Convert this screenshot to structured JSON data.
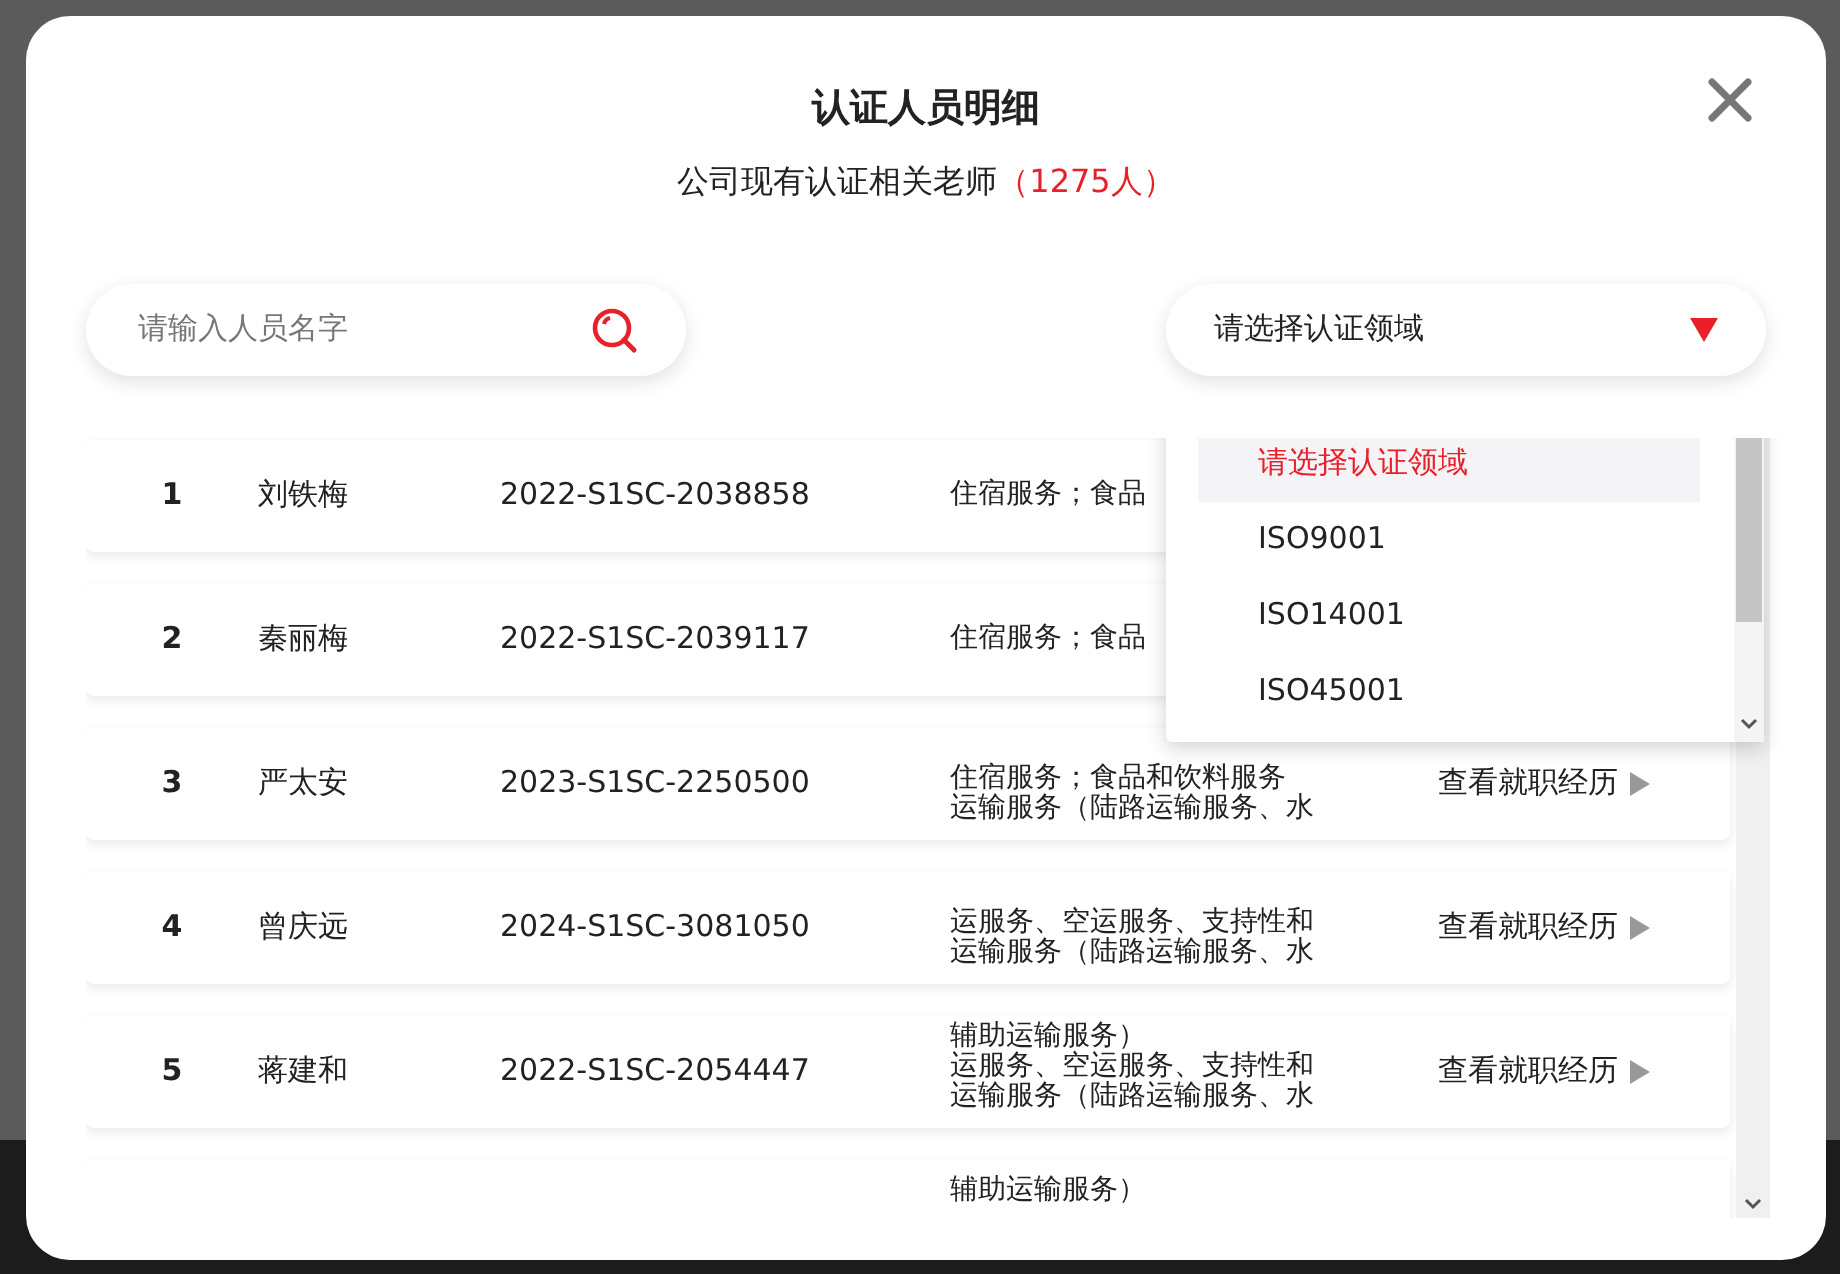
{
  "dialog": {
    "title": "认证人员明细",
    "subtitle": "公司现有认证相关老师",
    "count": "（1275人）"
  },
  "search": {
    "placeholder": "请输入人员名字"
  },
  "domain_select": {
    "value": "请选择认证领域",
    "expanded": true,
    "options": [
      {
        "label": "请选择认证领域",
        "selected": true
      },
      {
        "label": "ISO9001",
        "selected": false
      },
      {
        "label": "ISO14001",
        "selected": false
      },
      {
        "label": "ISO45001",
        "selected": false
      }
    ]
  },
  "rows": [
    {
      "no": "1",
      "name": "刘铁梅",
      "cert": "2022-S1SC-2038858",
      "services": [
        "住宿服务；食品"
      ],
      "link": null
    },
    {
      "no": "2",
      "name": "秦丽梅",
      "cert": "2022-S1SC-2039117",
      "services": [
        "住宿服务；食品"
      ],
      "link": null
    },
    {
      "no": "3",
      "name": "严太安",
      "cert": "2023-S1SC-2250500",
      "services": [
        "住宿服务；食品和饮料服务",
        "运输服务（陆路运输服务、水"
      ],
      "link": "查看就职经历"
    },
    {
      "no": "4",
      "name": "曾庆远",
      "cert": "2024-S1SC-3081050",
      "services": [
        "运服务、空运服务、支持性和",
        "运输服务（陆路运输服务、水"
      ],
      "link": "查看就职经历"
    },
    {
      "no": "5",
      "name": "蒋建和",
      "cert": "2022-S1SC-2054447",
      "services": [
        "辅助运输服务）",
        "运服务、空运服务、支持性和",
        "运输服务（陆路运输服务、水"
      ],
      "link": "查看就职经历"
    },
    {
      "services": [
        "辅助运输服务）"
      ]
    }
  ]
}
